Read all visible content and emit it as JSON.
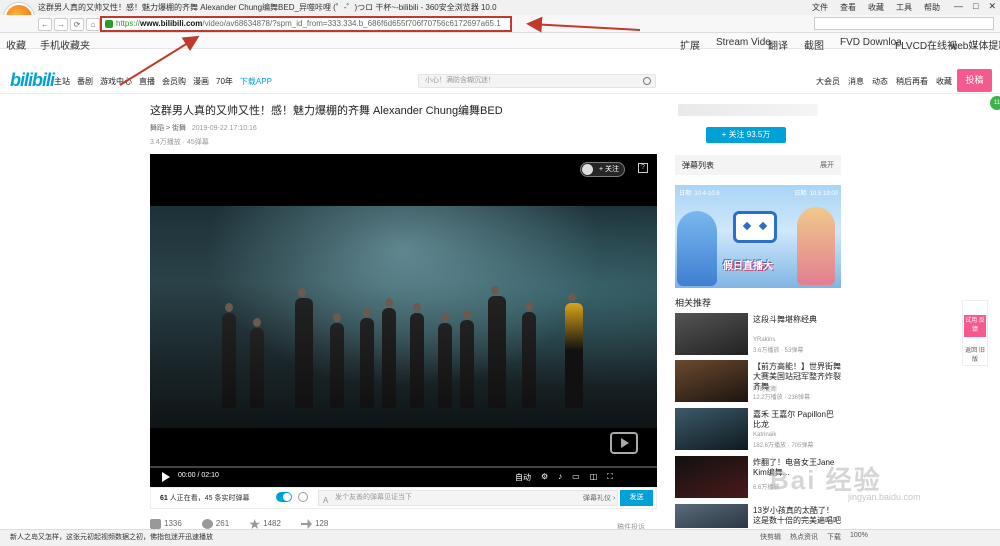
{
  "browser": {
    "window_title": "这群男人真的又帅又性！感！魅力爆棚的齐舞 Alexander Chung编舞BED_异噬咔哩 (゜-゜)つロ 干杯~-bilibili - 360安全浏览器 10.0",
    "menu": [
      "文件",
      "查看",
      "收藏",
      "工具",
      "帮助"
    ],
    "window_controls": [
      "—",
      "□",
      "✕"
    ],
    "nav_buttons": [
      "←",
      "→",
      "⟳",
      "⌂",
      "☆"
    ],
    "address": {
      "scheme": "https://",
      "host": "www.bilibili.com",
      "rest": "/video/av68634878/?spm_id_from=333.334.b_686f6d655f706f70756c6172697a65.1"
    },
    "bookmarks_left": [
      "收藏",
      "手机收藏夹"
    ],
    "bookmarks_right": [
      "扩展",
      "Stream Vide",
      "翻译",
      "截图",
      "FVD Downloa",
      "FLVCD在线视",
      "web媒体提取"
    ]
  },
  "bili": {
    "logo": "bilibili",
    "topnav": [
      "主站",
      "番剧",
      "游戏中心",
      "直播",
      "会员购",
      "漫画",
      "70年",
      "下载APP"
    ],
    "search_placeholder": "小心！满防含糊沉迷！",
    "rightnav": [
      "大会员",
      "消息",
      "动态",
      "稍后再看",
      "收藏",
      "历史"
    ],
    "upload_label": "投稿"
  },
  "video": {
    "title": "这群男人真的又帅又性！感！魅力爆棚的齐舞 Alexander Chung编舞BED",
    "category": "舞蹈 > 街舞",
    "date": "2019-09-22 17:10:16",
    "stats": "3.4万播放 · 45弹幕",
    "follow_chip": "+ 关注",
    "report_icon": "?",
    "time": "00:00 / 02:10",
    "quality": "自动",
    "danmaku_online": "61",
    "danmaku_text": "人正在看，45 条实时弹幕",
    "danmaku_placeholder": "发个友善的弹幕见证当下",
    "danmaku_input_icon": "A",
    "danmaku_etiquette": "弹幕礼仪 ›",
    "send_label": "发送",
    "actions": [
      {
        "icon": "like-icon",
        "count": "1336"
      },
      {
        "icon": "coin-icon",
        "count": "261"
      },
      {
        "icon": "star-icon",
        "count": "1482"
      },
      {
        "icon": "share-icon",
        "count": "128"
      }
    ],
    "report_link": "稿件投诉"
  },
  "sidebar": {
    "follow_button": "+ 关注 93.5万",
    "danmaku_list_title": "弹幕列表",
    "danmaku_list_expand": "展开",
    "banner_date_left": "日期: 10.4-10.6",
    "banner_date_right": "日期: 10.5 19:00",
    "banner_slogan": "假日直播大",
    "related_heading": "相关推荐",
    "related": [
      {
        "title": "这段斗舞堪称经典",
        "uploader": "YRakins",
        "stats": "3.6万播放 · 53弹幕"
      },
      {
        "title": "【前方高能！】世界街舞大赛美国站冠军整齐炸裂齐舞",
        "uploader": "阿司徒断",
        "stats": "12.2万播放 · 236弹幕"
      },
      {
        "title": "嘉禾 王嘉尔 Papillon巴比龙",
        "uploader": "Katrinaik",
        "stats": "182.6万播放 · 705弹幕"
      },
      {
        "title": "炸翻了！电音女王Jane Kim编舞...",
        "uploader": "",
        "stats": "6.6万播放"
      },
      {
        "title": "13岁小孩真的太酷了！这是数十倍的完美遍唱吧",
        "uploader": "",
        "stats": ""
      }
    ],
    "float_pink": "试用 反馈",
    "float_grey": "返回 旧版",
    "green_badge": "11"
  },
  "status": {
    "news": "新人之岛又怎样，这张元初起视频数据之初，佛指包迷开迅速播放",
    "right": [
      "快剪辑",
      "热点资讯",
      "下载",
      "100%"
    ]
  },
  "watermark": {
    "text": "Bai 经验",
    "sub": "jingyan.baidu.com"
  }
}
